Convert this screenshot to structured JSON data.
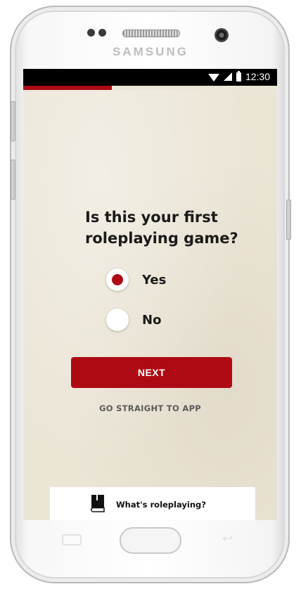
{
  "device": {
    "brand": "SAMSUNG"
  },
  "status_bar": {
    "time": "12:30"
  },
  "progress": {
    "fraction": 0.35
  },
  "question": {
    "text": "Is this your first roleplaying game?"
  },
  "options": [
    {
      "label": "Yes",
      "selected": true
    },
    {
      "label": "No",
      "selected": false
    }
  ],
  "buttons": {
    "next_label": "NEXT",
    "skip_label": "GO STRAIGHT TO APP"
  },
  "help_card": {
    "label": "What's roleplaying?",
    "icon": "book-icon"
  },
  "colors": {
    "accent": "#ae0a14",
    "paper": "#ebe5d6",
    "statusbar": "#000000"
  }
}
